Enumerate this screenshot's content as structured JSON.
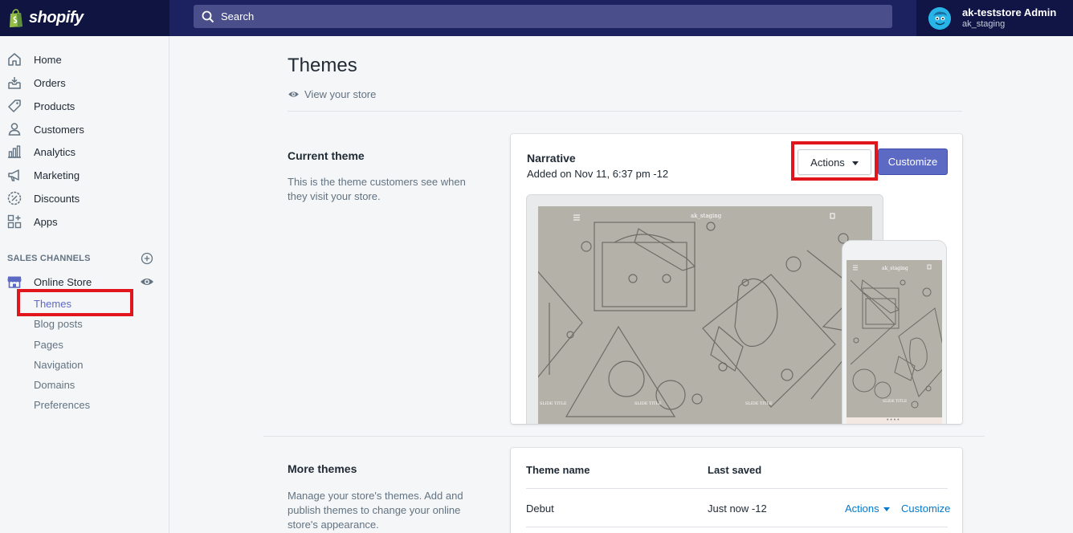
{
  "brand": {
    "logo_text": "shopify"
  },
  "search": {
    "label": "Search"
  },
  "account": {
    "name": "ak-teststore Admin",
    "store": "ak_staging"
  },
  "sidebar": {
    "items": [
      {
        "label": "Home",
        "icon": "home-icon"
      },
      {
        "label": "Orders",
        "icon": "orders-icon"
      },
      {
        "label": "Products",
        "icon": "tag-icon"
      },
      {
        "label": "Customers",
        "icon": "person-icon"
      },
      {
        "label": "Analytics",
        "icon": "bar-chart-icon"
      },
      {
        "label": "Marketing",
        "icon": "megaphone-icon"
      },
      {
        "label": "Discounts",
        "icon": "discount-icon"
      },
      {
        "label": "Apps",
        "icon": "apps-icon"
      }
    ],
    "sales_channels_heading": "SALES CHANNELS",
    "online_store_label": "Online Store",
    "online_store_subitems": [
      {
        "label": "Themes"
      },
      {
        "label": "Blog posts"
      },
      {
        "label": "Pages"
      },
      {
        "label": "Navigation"
      },
      {
        "label": "Domains"
      },
      {
        "label": "Preferences"
      }
    ]
  },
  "page": {
    "title": "Themes",
    "view_store": "View your store"
  },
  "current_theme": {
    "heading": "Current theme",
    "description": "This is the theme customers see when they visit your store.",
    "theme_name": "Narrative",
    "added": "Added on Nov 11, 6:37 pm -12",
    "actions_label": "Actions",
    "customize_label": "Customize",
    "preview_store_name": "ak_staging",
    "preview_slide_labels": [
      "SLIDE TITLE",
      "SLIDE TITLE",
      "SLIDE TITLE"
    ],
    "preview_dots": "• • • •"
  },
  "more_themes": {
    "heading": "More themes",
    "description": "Manage your store's themes. Add and publish themes to change your online store's appearance.",
    "columns": [
      "Theme name",
      "Last saved"
    ],
    "rows": [
      {
        "name": "Debut",
        "last_saved": "Just now -12",
        "actions_label": "Actions",
        "customize_label": "Customize"
      }
    ]
  },
  "colors": {
    "primary": "#5c6ac4",
    "link": "#007ace",
    "highlight": "#e0161c",
    "topbar": "#1c2260"
  }
}
